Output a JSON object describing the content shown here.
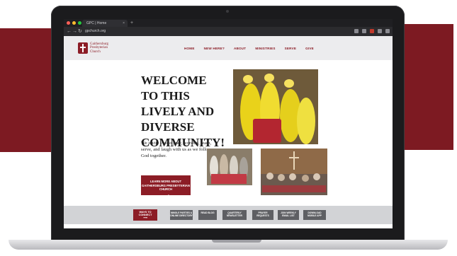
{
  "browser": {
    "tab_title": "GPC | Home",
    "new_tab_glyph": "+",
    "url": "gpchurch.org",
    "nav_back": "←",
    "nav_forward": "→",
    "nav_reload": "↻"
  },
  "site": {
    "logo_line1": "Gaithersburg",
    "logo_line2": "Presbyterian",
    "logo_line3": "Church",
    "menu": [
      "HOME",
      "NEW HERE?",
      "ABOUT",
      "MINISTRIES",
      "SERVE",
      "GIVE"
    ]
  },
  "hero": {
    "title": "WELCOME TO THIS LIVELY AND DIVERSE COMMUNITY!",
    "body": "We invite you to pray, worship, learn, serve, and laugh with us as we follow God together.",
    "cta_label": "LEARN MORE ABOUT GAITHERSBURG PRESBYTERIAN CHURCH",
    "cta_arrow": "⟶"
  },
  "bottom_buttons": [
    {
      "label": "WAYS TO CONNECT",
      "arrow": "⟶"
    },
    {
      "label": "MINGLE PARTIES & ONLINE DIRECTORY"
    },
    {
      "label": "READ BLOG"
    },
    {
      "label": "QUARTERLY NEWSLETTER"
    },
    {
      "label": "PRAYER REQUESTS"
    },
    {
      "label": "JOIN WEEKLY EMAIL LIST"
    },
    {
      "label": "DOWNLOAD MOBILE APP"
    }
  ],
  "colors": {
    "brand_maroon": "#8c1d26",
    "decor_maroon": "#7d1a22",
    "strip_bg": "#d2d3d6",
    "button_gray": "#5e5f63"
  }
}
